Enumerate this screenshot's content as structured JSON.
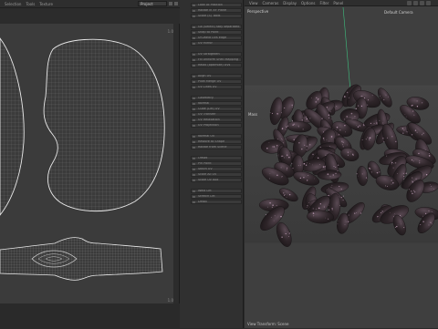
{
  "uv_editor": {
    "menu": [
      "Selection",
      "Tools",
      "Texture"
    ],
    "projection_select": "Project",
    "range_top": "1.0",
    "range_bottom": "1.0"
  },
  "tool_panel": {
    "items": [
      "Look At Position",
      "Rotate in XY Plane",
      "Scale (S) Tools",
      "Go (Select) stay separated",
      "Snap to Point",
      "Un-Weld UVs edge",
      "UV Mirror",
      "UV Straighten",
      "Fill Uniform Shell Mapping",
      "Relax (optimize) UVs",
      "Align UV",
      "Pixel Merge UV",
      "UV Lines UV",
      "Geometry",
      "Normal",
      "Cube (Lift) UV",
      "UV Transfer",
      "UV Relaxation",
      "UV Projection",
      "Normal UV",
      "Restore to Shape",
      "Rotate from Scene",
      "Offset",
      "Pin Paint",
      "Stitch UV",
      "Scale All UV",
      "Scale UV Box",
      "Weld Lift",
      "Stretch Lift",
      "Detail"
    ]
  },
  "viewport": {
    "menu": [
      "View",
      "Cameras",
      "Display",
      "Options",
      "Filter",
      "Panel"
    ],
    "view_name": "Perspective",
    "camera_name": "Default Camera",
    "object_label": "Mass",
    "status": "View Transform: Scene",
    "axis_color": "#3fbf7f"
  },
  "colors": {
    "uv_background": "#3b3b3b",
    "uv_wire": "#e8e8e8",
    "viewport_background": "#3f3f3f",
    "bean_dark": "#2a2226",
    "bean_speckle": "#c9a7c1"
  }
}
